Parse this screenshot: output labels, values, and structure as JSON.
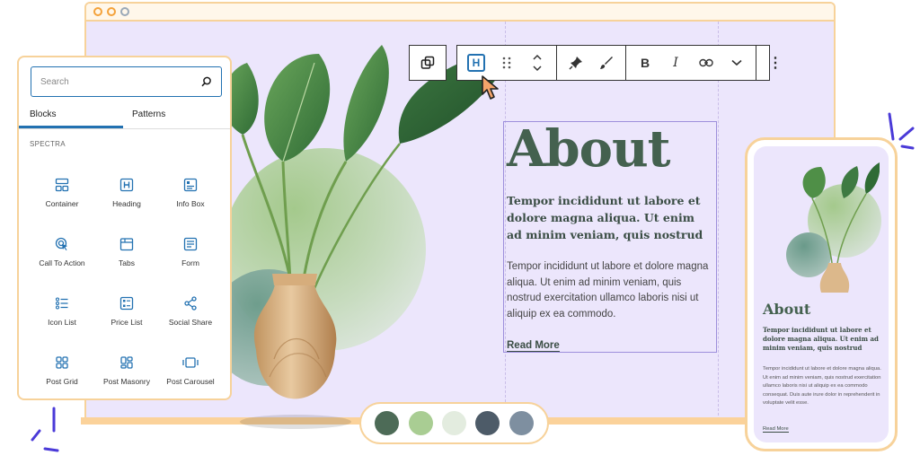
{
  "browser": {
    "dots": [
      "close",
      "minimize",
      "maximize"
    ]
  },
  "toolbar": {
    "transform_icon": "block-transform-icon",
    "heading_badge": "H",
    "items": [
      "heading-block-icon",
      "drag-handle-icon",
      "move-up-down-icon",
      "pin-icon",
      "brush-icon",
      "bold-icon",
      "italic-icon",
      "link-icon",
      "chevron-down-icon",
      "more-options-icon"
    ],
    "bold": "B",
    "italic": "I",
    "more": "⋮"
  },
  "content": {
    "title": "About",
    "subheading": "Tempor incididunt ut labore et dolore magna aliqua. Ut enim ad minim veniam, quis nostrud",
    "paragraph": "Tempor incididunt ut labore et dolore magna aliqua. Ut enim ad minim veniam, quis nostrud exercitation ullamco laboris nisi ut aliquip ex ea commodo.",
    "read_more": "Read More"
  },
  "sidebar": {
    "search_placeholder": "Search",
    "tabs": [
      "Blocks",
      "Patterns"
    ],
    "section": "SPECTRA",
    "blocks": [
      {
        "label": "Container",
        "icon": "container-icon"
      },
      {
        "label": "Heading",
        "icon": "heading-icon"
      },
      {
        "label": "Info Box",
        "icon": "info-box-icon"
      },
      {
        "label": "Call To Action",
        "icon": "call-to-action-icon"
      },
      {
        "label": "Tabs",
        "icon": "tabs-icon"
      },
      {
        "label": "Form",
        "icon": "form-icon"
      },
      {
        "label": "Icon List",
        "icon": "icon-list-icon"
      },
      {
        "label": "Price List",
        "icon": "price-list-icon"
      },
      {
        "label": "Social Share",
        "icon": "social-share-icon"
      },
      {
        "label": "Post Grid",
        "icon": "post-grid-icon"
      },
      {
        "label": "Post Masonry",
        "icon": "post-masonry-icon"
      },
      {
        "label": "Post Carousel",
        "icon": "post-carousel-icon"
      }
    ]
  },
  "palette": [
    "#4d6b57",
    "#a9cd93",
    "#e3ecdf",
    "#4d5b68",
    "#7e8fa0"
  ],
  "phone": {
    "title": "About",
    "subheading": "Tempor incididunt ut labore et dolore magna aliqua. Ut enim ad minim veniam, quis nostrud",
    "paragraph": "Tempor incididunt ut labore et dolore magna aliqua. Ut enim ad minim veniam, quis nostrud exercitation ullamco laboris nisi ut aliquip ex ea commodo consequat. Duis aute irure dolor in reprehenderit in voluptate velit esse.",
    "read_more": "Read More"
  },
  "colors": {
    "accent": "#2271b1",
    "frame": "#f7d29a",
    "canvas": "#ece6fc",
    "title": "#44614f",
    "selection": "#9e8fdc"
  }
}
